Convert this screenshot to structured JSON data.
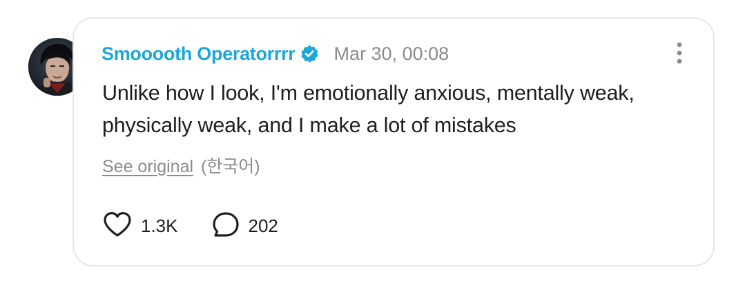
{
  "post": {
    "author_name": "Smooooth Operatorrrr",
    "verified_badge_icon": "verified-badge-icon",
    "timestamp": "Mar 30, 00:08",
    "text": "Unlike how I look, I'm emotionally anxious, mentally weak, physically weak, and I make a lot of mistakes",
    "translation": {
      "link_label": "See original",
      "language_label": "(한국어)"
    },
    "actions": {
      "like_icon": "heart-icon",
      "like_count": "1.3K",
      "comment_icon": "speech-bubble-icon",
      "comment_count": "202"
    },
    "menu_icon": "more-vertical-icon"
  },
  "colors": {
    "author_name": "#1ca7d8",
    "verified_badge": "#1ca7d8",
    "muted_text": "#8a8a90",
    "body_text": "#1e1e22",
    "card_border": "#e6e6ea"
  }
}
